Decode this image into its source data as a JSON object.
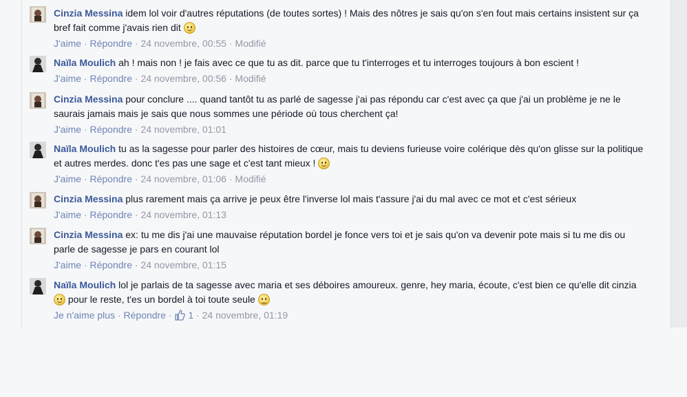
{
  "comments": [
    {
      "author": "Cinzia Messina",
      "text": "idem lol voir d'autres réputations (de toutes sortes) ! Mais des nôtres je sais qu'on s'en fout mais certains insistent sur ça bref fait comme j'avais rien dit",
      "like": "J'aime",
      "reply": "Répondre",
      "date": "24 novembre, 00:55",
      "edited": "Modifié"
    },
    {
      "author": "Naïla Moulich",
      "text": "ah ! mais non ! je fais avec ce que tu as dit. parce que tu t'interroges et tu interroges toujours à bon escient !",
      "like": "J'aime",
      "reply": "Répondre",
      "date": "24 novembre, 00:56",
      "edited": "Modifié"
    },
    {
      "author": "Cinzia Messina",
      "text": "pour conclure .... quand tantôt tu as parlé de sagesse j'ai pas répondu car c'est avec ça que j'ai un problème je ne le saurais jamais mais je sais que nous sommes une période où tous cherchent ça!",
      "like": "J'aime",
      "reply": "Répondre",
      "date": "24 novembre, 01:01"
    },
    {
      "author": "Naïla Moulich",
      "text": "tu as la sagesse pour parler des histoires de cœur, mais tu deviens furieuse voire colérique dès qu'on glisse sur la politique et autres merdes. donc t'es pas une sage et c'est tant mieux !",
      "like": "J'aime",
      "reply": "Répondre",
      "date": "24 novembre, 01:06",
      "edited": "Modifié"
    },
    {
      "author": "Cinzia Messina",
      "text": "plus rarement mais ça arrive je peux être l'inverse lol mais t'assure j'ai du mal avec ce mot et c'est sérieux",
      "like": "J'aime",
      "reply": "Répondre",
      "date": "24 novembre, 01:13"
    },
    {
      "author": "Cinzia Messina",
      "text": "ex: tu me dis j'ai une mauvaise réputation bordel je fonce vers toi et je sais qu'on va devenir pote mais si tu me dis ou parle de sagesse je pars en courant lol",
      "like": "J'aime",
      "reply": "Répondre",
      "date": "24 novembre, 01:15"
    },
    {
      "author": "Naïla Moulich",
      "text_a": "lol je parlais de ta sagesse avec maria et ses déboires amoureux. genre, hey maria, écoute, c'est bien ce qu'elle dit cinzia",
      "text_b": "pour le reste, t'es un bordel à toi toute seule",
      "like": "Je n'aime plus",
      "reply": "Répondre",
      "like_count": "1",
      "date": "24 novembre, 01:19"
    }
  ],
  "separator": "·",
  "icons": {
    "avatar": "profile-photo",
    "smile": "smile-emoticon",
    "like": "thumbs-up-icon"
  },
  "colors": {
    "author": "#3b5998",
    "link": "#6d84b4",
    "meta": "#9197a3"
  }
}
